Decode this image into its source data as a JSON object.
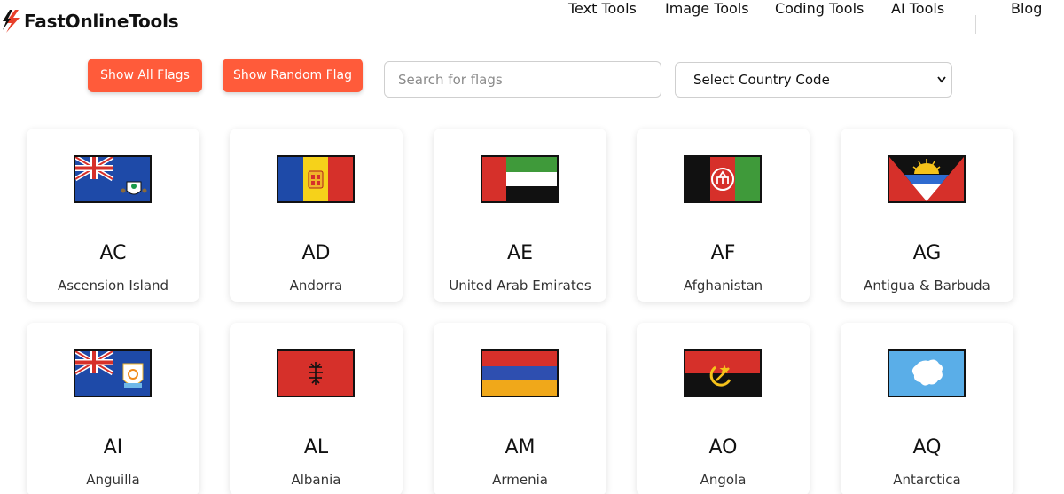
{
  "header": {
    "logo_text": "FastOnlineTools",
    "nav": [
      {
        "label": "Text Tools"
      },
      {
        "label": "Image Tools"
      },
      {
        "label": "Coding Tools"
      },
      {
        "label": "AI Tools"
      },
      {
        "label": "Blog"
      }
    ]
  },
  "toolbar": {
    "show_all_label": "Show All Flags",
    "show_random_label": "Show Random Flag",
    "search_placeholder": "Search for flags",
    "select_value": "Select Country Code"
  },
  "colors": {
    "accent": "#ff5b3a"
  },
  "flags": [
    {
      "code": "AC",
      "name": "Ascension Island"
    },
    {
      "code": "AD",
      "name": "Andorra"
    },
    {
      "code": "AE",
      "name": "United Arab Emirates"
    },
    {
      "code": "AF",
      "name": "Afghanistan"
    },
    {
      "code": "AG",
      "name": "Antigua & Barbuda"
    },
    {
      "code": "AI",
      "name": "Anguilla"
    },
    {
      "code": "AL",
      "name": "Albania"
    },
    {
      "code": "AM",
      "name": "Armenia"
    },
    {
      "code": "AO",
      "name": "Angola"
    },
    {
      "code": "AQ",
      "name": "Antarctica"
    }
  ]
}
